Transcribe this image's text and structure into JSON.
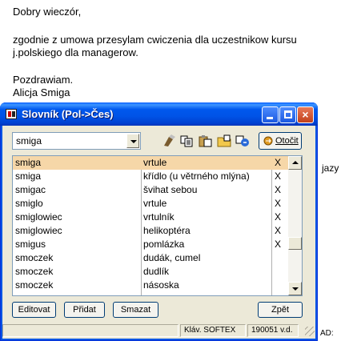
{
  "email": {
    "greeting": "Dobry wieczór,",
    "body_line_1": "zgodnie z umowa przesylam cwiczenia dla uczestnikow kursu",
    "body_line_2": "j.polskiego dla managerow.",
    "closing": "Pozdrawiam.",
    "signature": "Alicja Smiga",
    "partial_right_text": "jazy",
    "partial_bottom_text": "AD:"
  },
  "window": {
    "title": "Slovník (Pol->Čes)",
    "controls": {
      "minimize": "minimize",
      "maximize": "maximize",
      "close": "×"
    }
  },
  "toolbar": {
    "search_value": "smiga",
    "icons": [
      "eraser-icon",
      "copy-icon",
      "paste-icon",
      "folder-icon",
      "swap-icon"
    ],
    "swap_label": "Otočit"
  },
  "entries": [
    {
      "polish": "smiga",
      "czech": "vrtule",
      "mark": "X",
      "selected": true
    },
    {
      "polish": "smiga",
      "czech": "křídlo (u větrného mlýna)",
      "mark": "X"
    },
    {
      "polish": "smigac",
      "czech": "švihat sebou",
      "mark": "X"
    },
    {
      "polish": "smiglo",
      "czech": "vrtule",
      "mark": "X"
    },
    {
      "polish": "smiglowiec",
      "czech": "vrtulník",
      "mark": "X"
    },
    {
      "polish": "smiglowiec",
      "czech": "helikoptéra",
      "mark": "X"
    },
    {
      "polish": "smigus",
      "czech": "pomlázka",
      "mark": "X"
    },
    {
      "polish": "smoczek",
      "czech": "dudák, cumel",
      "mark": ""
    },
    {
      "polish": "smoczek",
      "czech": "dudlík",
      "mark": ""
    },
    {
      "polish": "smoczek",
      "czech": "násoska",
      "mark": ""
    }
  ],
  "buttons": {
    "edit": "Editovat",
    "add": "Přidat",
    "delete": "Smazat",
    "back": "Zpět"
  },
  "status": {
    "keyboard": "Kláv. SOFTEX",
    "version": "190051 v.d."
  },
  "colors": {
    "title_blue": "#0058ee",
    "selected_row": "#f6d7a8",
    "window_face": "#ece9d8"
  }
}
